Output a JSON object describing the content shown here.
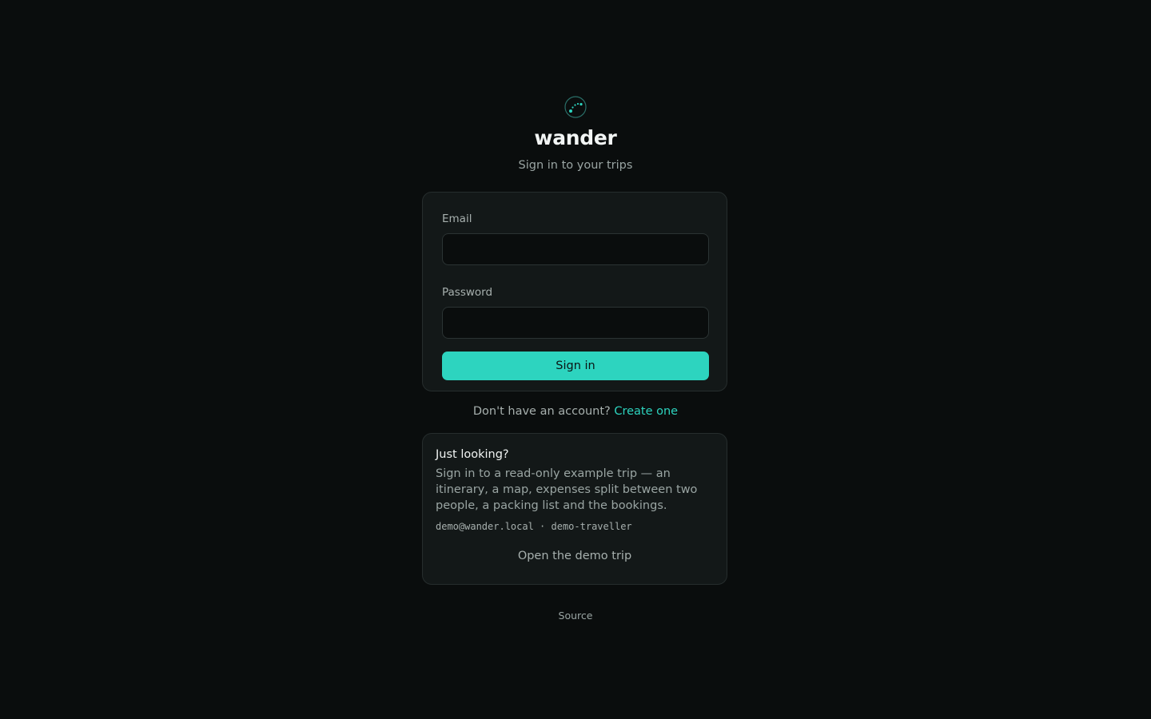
{
  "brand": {
    "logo_icon": "route-dots-icon",
    "title": "wander",
    "subtitle": "Sign in to your trips",
    "accent_color": "#2dd4bf"
  },
  "login": {
    "email_label": "Email",
    "email_value": "",
    "email_placeholder": "",
    "password_label": "Password",
    "password_value": "",
    "password_placeholder": "",
    "submit_label": "Sign in"
  },
  "signup": {
    "prompt": "Don't have an account?",
    "link_label": "Create one"
  },
  "demo": {
    "title": "Just looking?",
    "description": "Sign in to a read-only example trip — an itinerary, a map, expenses split between two people, a packing list and the bookings.",
    "credentials": "demo@wander.local · demo-traveller",
    "button_label": "Open the demo trip"
  },
  "footer": {
    "source_label": "Source"
  }
}
